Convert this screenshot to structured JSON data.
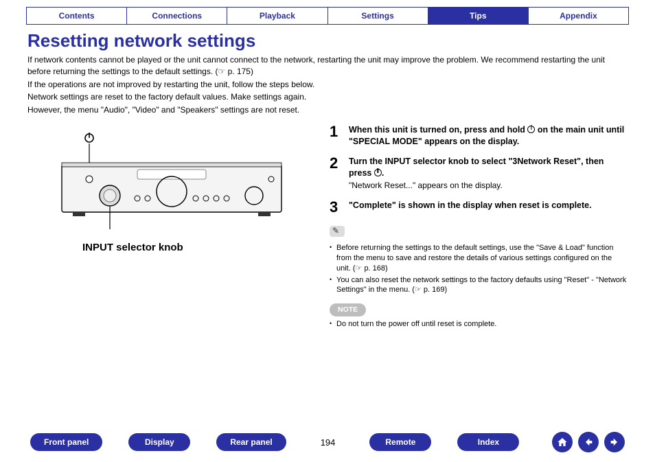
{
  "tabs": {
    "contents": "Contents",
    "connections": "Connections",
    "playback": "Playback",
    "settings": "Settings",
    "tips": "Tips",
    "appendix": "Appendix",
    "active": "tips"
  },
  "title": "Resetting network settings",
  "intro": {
    "p1": "If network contents cannot be played or the unit cannot connect to the network, restarting the unit may improve the problem. We recommend restarting the unit before returning the settings to the default settings. (",
    "p1_ref": " p. 175)",
    "p2": "If the operations are not improved by restarting the unit, follow the steps below.",
    "p3": "Network settings are reset to the factory default values. Make settings again.",
    "p4": "However, the menu \"Audio\", \"Video\" and \"Speakers\" settings are not reset."
  },
  "diagram": {
    "input_selector_label": "INPUT selector knob"
  },
  "steps": {
    "s1_num": "1",
    "s1_a": "When this unit is turned on, press and hold ",
    "s1_b": " on the main unit until \"SPECIAL MODE\" appears on the display.",
    "s2_num": "2",
    "s2_a": "Turn the INPUT selector knob to select \"3Network Reset\", then press ",
    "s2_b": ".",
    "s2_sub": "\"Network Reset...\" appears on the display.",
    "s3_num": "3",
    "s3_title": "\"Complete\" is shown in the display when reset is complete."
  },
  "notes": {
    "b1a": "Before returning the settings to the default settings, use the \"Save & Load\" function from the menu to save and restore the details of various settings configured on the unit. (",
    "b1_ref": " p. 168)",
    "b2a": "You can also reset the network settings to the factory defaults using \"Reset\" - \"Network Settings\" in the menu. (",
    "b2_ref": " p. 169)"
  },
  "note_badge": "NOTE",
  "note_warning": "Do not turn the power off until reset is complete.",
  "bottom": {
    "front_panel": "Front panel",
    "display": "Display",
    "rear_panel": "Rear panel",
    "page": "194",
    "remote": "Remote",
    "index": "Index"
  },
  "pointer_glyph": "☞"
}
